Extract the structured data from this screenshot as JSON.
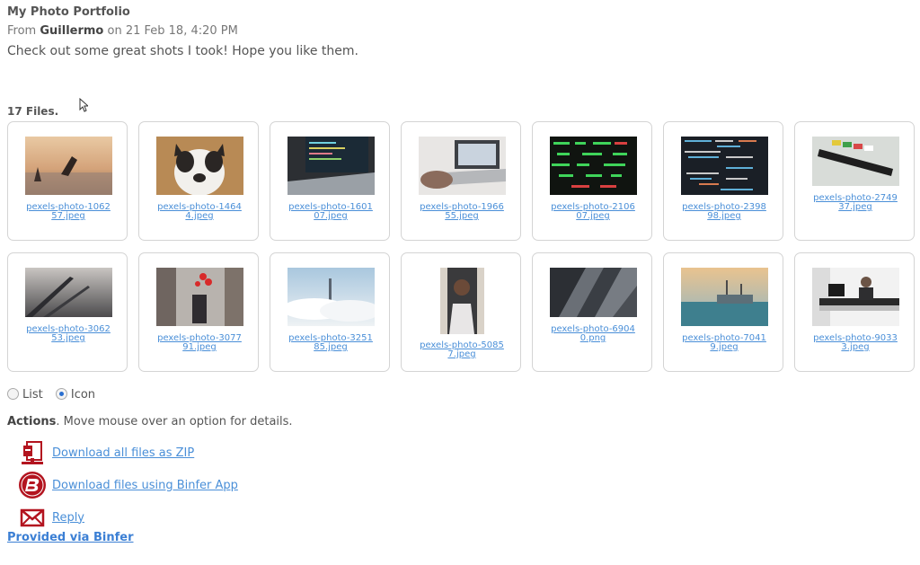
{
  "header": {
    "title": "My Photo Portfolio",
    "from_prefix": "From",
    "sender": "Guillermo",
    "date_text": "on 21 Feb 18, 4:20 PM",
    "message": "Check out some great shots I took! Hope you like them."
  },
  "files": {
    "count_label": "17 Files.",
    "items": [
      {
        "name": "pexels-photo-106257.jpeg",
        "icon": "beach-jumper-photo"
      },
      {
        "name": "pexels-photo-14644.jpeg",
        "icon": "bulldog-photo"
      },
      {
        "name": "pexels-photo-160107.jpeg",
        "icon": "laptop-code-photo"
      },
      {
        "name": "pexels-photo-196655.jpeg",
        "icon": "laptop-desk-photo"
      },
      {
        "name": "pexels-photo-210607.jpeg",
        "icon": "stock-ticker-photo"
      },
      {
        "name": "pexels-photo-239898.jpeg",
        "icon": "code-screen-photo"
      },
      {
        "name": "pexels-photo-274937.jpeg",
        "icon": "clapperboard-photo"
      },
      {
        "name": "pexels-photo-306253.jpeg",
        "icon": "bridge-sunset-photo"
      },
      {
        "name": "pexels-photo-307791.jpeg",
        "icon": "couple-street-photo"
      },
      {
        "name": "pexels-photo-325185.jpeg",
        "icon": "fog-city-photo"
      },
      {
        "name": "pexels-photo-50857.jpeg",
        "icon": "woman-portrait-photo"
      },
      {
        "name": "pexels-photo-69040.png",
        "icon": "building-facade-photo"
      },
      {
        "name": "pexels-photo-70419.jpeg",
        "icon": "harbor-boats-photo"
      },
      {
        "name": "pexels-photo-90333.jpeg",
        "icon": "office-man-photo"
      }
    ]
  },
  "view": {
    "list_label": "List",
    "icon_label": "Icon",
    "selected": "Icon"
  },
  "actions": {
    "heading": "Actions",
    "hint": ". Move mouse over an option for details.",
    "download_zip": "Download all files as ZIP",
    "download_app": "Download files using Binfer App",
    "reply": "Reply"
  },
  "footer": {
    "provided": "Provided via Binfer"
  },
  "colors": {
    "link": "#4a8fd8",
    "binfer_red": "#b3141f"
  }
}
